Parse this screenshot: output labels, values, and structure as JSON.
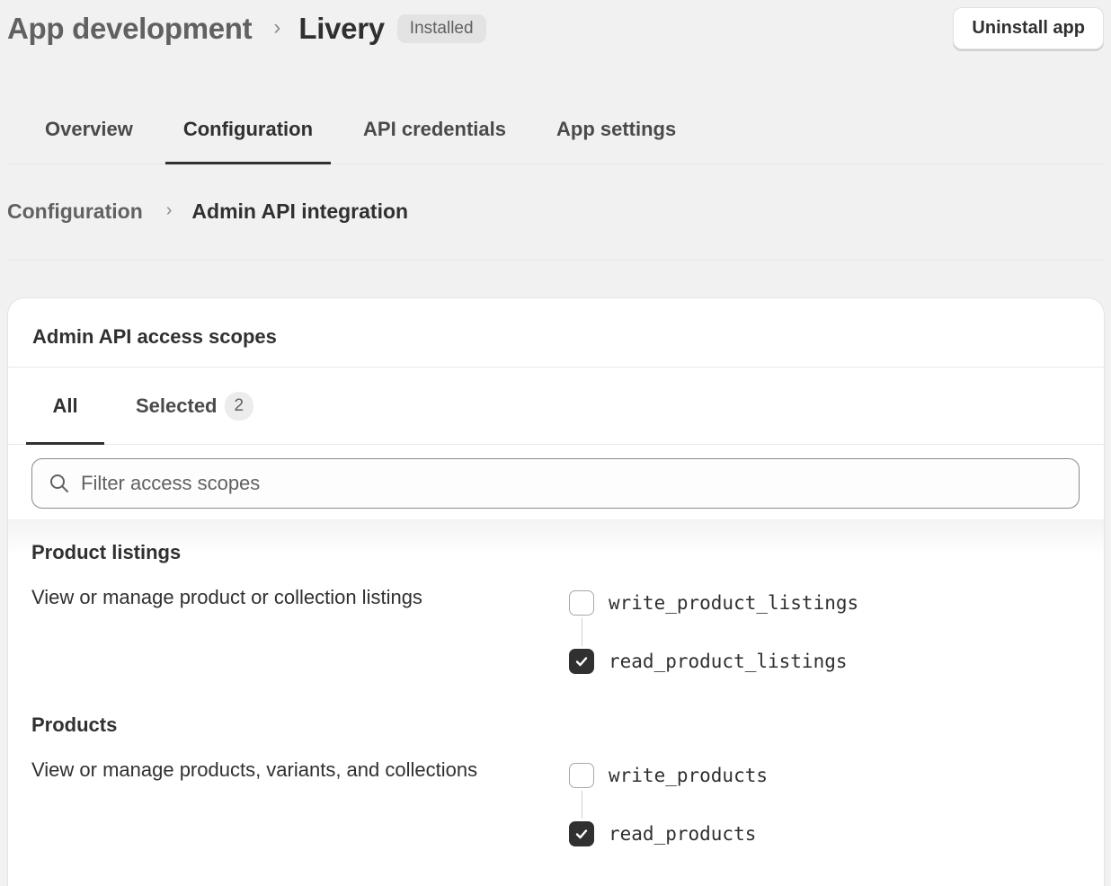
{
  "header": {
    "parent": "App development",
    "separator": "›",
    "app_name": "Livery",
    "status_badge": "Installed",
    "uninstall_label": "Uninstall app"
  },
  "tabs": [
    {
      "label": "Overview",
      "active": false
    },
    {
      "label": "Configuration",
      "active": true
    },
    {
      "label": "API credentials",
      "active": false
    },
    {
      "label": "App settings",
      "active": false
    }
  ],
  "subcrumb": {
    "parent": "Configuration",
    "separator": "›",
    "current": "Admin API integration"
  },
  "card": {
    "title": "Admin API access scopes",
    "scope_tabs": {
      "all": "All",
      "selected": "Selected",
      "selected_count": "2"
    },
    "search_placeholder": "Filter access scopes",
    "groups": [
      {
        "title": "Product listings",
        "description": "View or manage product or collection listings",
        "scopes": [
          {
            "name": "write_product_listings",
            "checked": false
          },
          {
            "name": "read_product_listings",
            "checked": true
          }
        ]
      },
      {
        "title": "Products",
        "description": "View or manage products, variants, and collections",
        "scopes": [
          {
            "name": "write_products",
            "checked": false
          },
          {
            "name": "read_products",
            "checked": true
          }
        ]
      }
    ]
  },
  "colors": {
    "background": "#f1f1f1",
    "text": "#303030",
    "muted": "#616161",
    "checkbox_checked": "#303030"
  },
  "icons": {
    "search": "search-icon",
    "check": "checkmark-icon"
  }
}
